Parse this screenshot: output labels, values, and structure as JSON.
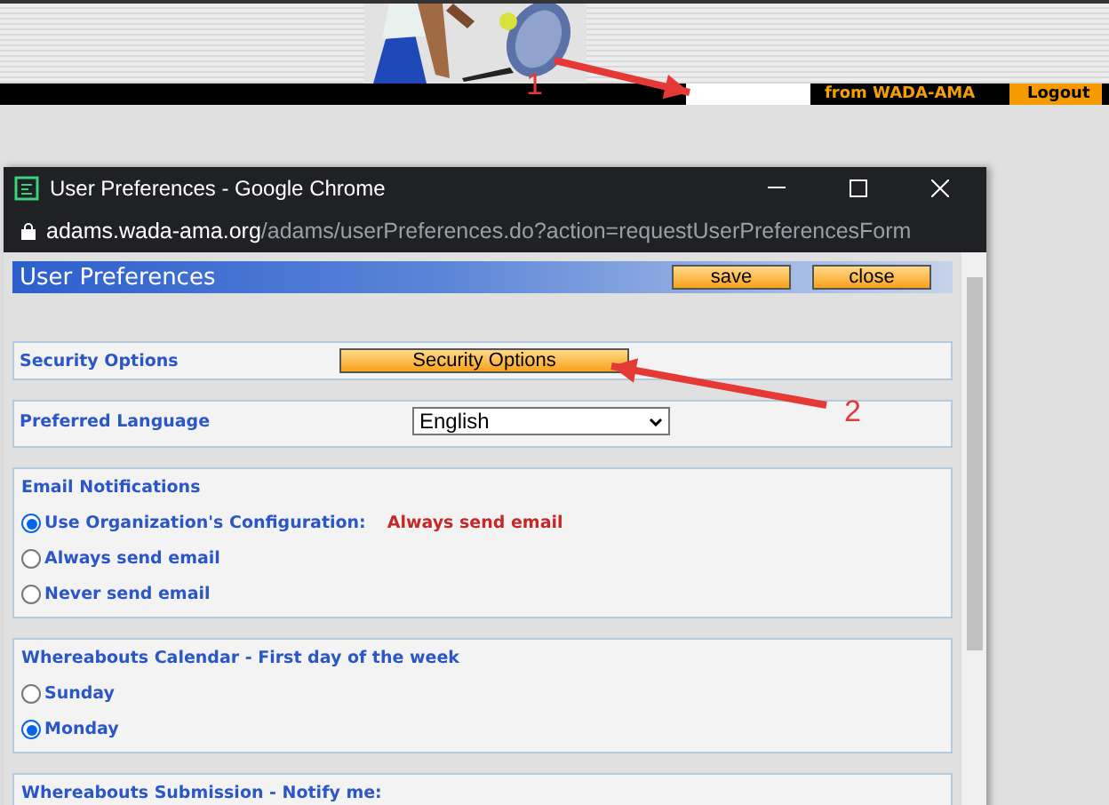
{
  "banner": {
    "from_label": "from WADA-AMA",
    "logout": "Logout"
  },
  "popup": {
    "title": "User Preferences - Google Chrome",
    "url_host": "adams.wada-ama.org",
    "url_path": "/adams/userPreferences.do?action=requestUserPreferencesForm"
  },
  "page": {
    "heading": "User Preferences",
    "buttons": [
      "save",
      "close"
    ],
    "security": {
      "label": "Security Options",
      "button": "Security Options"
    },
    "language": {
      "label": "Preferred Language",
      "value": "English"
    },
    "groups": [
      {
        "title": "Email Notifications",
        "options": [
          {
            "label": "Use Organization's Configuration:",
            "note": "Always send email",
            "selected": true
          },
          {
            "label": "Always send email",
            "selected": false
          },
          {
            "label": "Never send email",
            "selected": false
          }
        ]
      },
      {
        "title": "Whereabouts Calendar - First day of the week",
        "options": [
          {
            "label": "Sunday",
            "selected": false
          },
          {
            "label": "Monday",
            "selected": true
          }
        ]
      },
      {
        "title": "Whereabouts Submission - Notify me:"
      }
    ]
  },
  "annotations": [
    {
      "label": "1"
    },
    {
      "label": "2"
    }
  ]
}
